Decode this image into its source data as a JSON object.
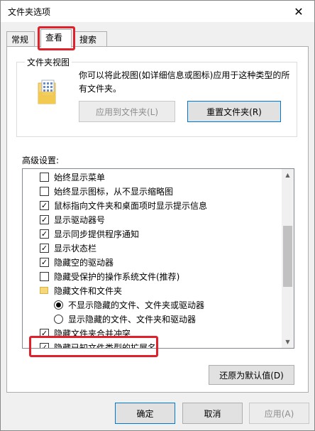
{
  "window": {
    "title": "文件夹选项",
    "close_glyph": "✕"
  },
  "tabs": [
    {
      "label": "常规",
      "active": false
    },
    {
      "label": "查看",
      "active": true
    },
    {
      "label": "搜索",
      "active": false
    }
  ],
  "folder_views": {
    "group_title": "文件夹视图",
    "description": "你可以将此视图(如详细信息或图标)应用于这种类型的所有文件夹。",
    "apply_button": "应用到文件夹(L)",
    "reset_button": "重置文件夹(R)"
  },
  "advanced": {
    "label": "高级设置:",
    "items": [
      {
        "type": "checkbox",
        "checked": false,
        "label": "始终显示菜单"
      },
      {
        "type": "checkbox",
        "checked": false,
        "label": "始终显示图标，从不显示缩略图"
      },
      {
        "type": "checkbox",
        "checked": true,
        "label": "鼠标指向文件夹和桌面项时显示提示信息"
      },
      {
        "type": "checkbox",
        "checked": true,
        "label": "显示驱动器号"
      },
      {
        "type": "checkbox",
        "checked": true,
        "label": "显示同步提供程序通知"
      },
      {
        "type": "checkbox",
        "checked": true,
        "label": "显示状态栏"
      },
      {
        "type": "checkbox",
        "checked": true,
        "label": "隐藏空的驱动器"
      },
      {
        "type": "checkbox",
        "checked": false,
        "label": "隐藏受保护的操作系统文件(推荐)"
      },
      {
        "type": "folder",
        "label": "隐藏文件和文件夹"
      },
      {
        "type": "radio",
        "checked": true,
        "label": "不显示隐藏的文件、文件夹或驱动器"
      },
      {
        "type": "radio",
        "checked": false,
        "label": "显示隐藏的文件、文件夹和驱动器"
      },
      {
        "type": "checkbox",
        "checked": true,
        "label": "隐藏文件夹合并冲突"
      },
      {
        "type": "checkbox",
        "checked": true,
        "label": "隐藏已知文件类型的扩展名"
      }
    ],
    "restore_button": "还原为默认值(D)"
  },
  "footer": {
    "ok_button": "确定",
    "cancel_button": "取消",
    "apply_button": "应用(A)"
  },
  "colors": {
    "highlight": "#e0202a",
    "focus": "#0078d7"
  }
}
